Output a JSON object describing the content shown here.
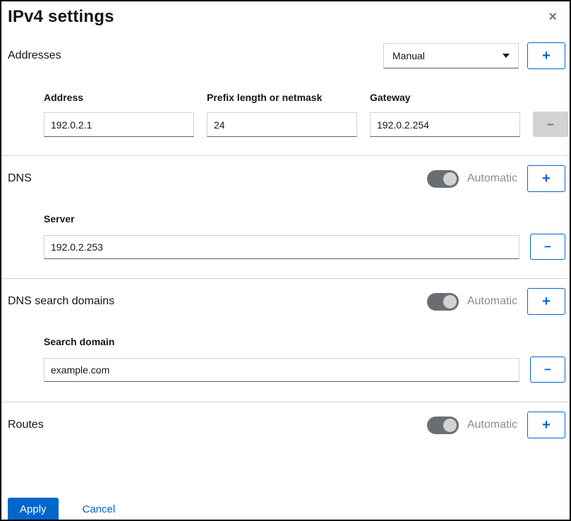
{
  "dialog": {
    "title": "IPv4 settings",
    "close_glyph": "×"
  },
  "colors": {
    "accent_blue": "#0066cc",
    "text_dark": "#151515",
    "muted_gray": "#8a8d90",
    "toggle_track": "#6a6e73",
    "toggle_knob": "#d2d2d2",
    "disabled_button_bg": "#d2d2d2",
    "input_border": "#d2d2d2",
    "input_border_bottom": "#5c5f63"
  },
  "addresses": {
    "label": "Addresses",
    "method_select": {
      "value": "Manual",
      "icon": "caret-down-icon"
    },
    "add_label": "+",
    "remove_label": "−",
    "remove_disabled": true,
    "columns": [
      {
        "label": "Address",
        "value": "192.0.2.1"
      },
      {
        "label": "Prefix length or netmask",
        "value": "24"
      },
      {
        "label": "Gateway",
        "value": "192.0.2.254"
      }
    ]
  },
  "dns": {
    "label": "DNS",
    "automatic": true,
    "toggle_label": "Automatic",
    "add_label": "+",
    "remove_label": "−",
    "field": {
      "label": "Server",
      "value": "192.0.2.253"
    }
  },
  "dns_search": {
    "label": "DNS search domains",
    "automatic": true,
    "toggle_label": "Automatic",
    "add_label": "+",
    "remove_label": "−",
    "field": {
      "label": "Search domain",
      "value": "example.com"
    }
  },
  "routes": {
    "label": "Routes",
    "automatic": true,
    "toggle_label": "Automatic",
    "add_label": "+"
  },
  "footer": {
    "apply_label": "Apply",
    "cancel_label": "Cancel"
  }
}
